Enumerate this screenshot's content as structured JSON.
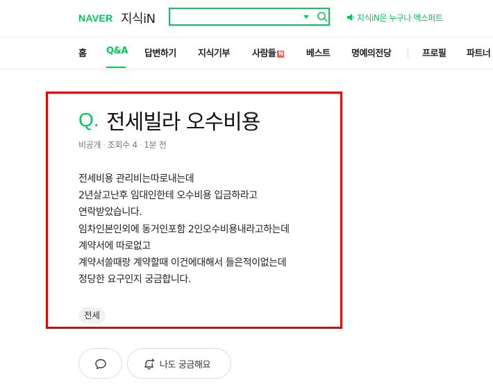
{
  "header": {
    "naver_logo": "NAVER",
    "service_logo": "지식iN",
    "search": {
      "value": "",
      "placeholder": ""
    },
    "notice_text": "지식iN은 누구나 엑스퍼트"
  },
  "nav": {
    "items": [
      {
        "label": "홈"
      },
      {
        "label": "Q&A",
        "active": true
      },
      {
        "label": "답변하기"
      },
      {
        "label": "지식기부"
      },
      {
        "label": "사람들",
        "badge": "N"
      },
      {
        "label": "베스트"
      },
      {
        "label": "명예의전당"
      },
      {
        "label": "프로필"
      },
      {
        "label": "파트너"
      }
    ]
  },
  "question": {
    "q_mark": "Q.",
    "title": "전세빌라 오수비용",
    "meta": {
      "visibility": "비공개",
      "views": "조회수 4",
      "time": "1분 전"
    },
    "body_lines": [
      "전세비용 관리비는따로내는데",
      "2년살고난후 임대인한테 오수비용 입금하라고",
      "연락받았습니다.",
      "임차인본인외에 동거인포함 2인오수비용내라고하는데",
      "계약서에 따로없고",
      "계약서쓸때랑 계약할때 이건에대해서 들은적이없는데",
      "정당한 요구인지 궁금합니다."
    ],
    "tag": "전세"
  },
  "actions": {
    "curious_label": "나도 궁금해요"
  },
  "colors": {
    "brand_green": "#03c75a",
    "highlight_red": "#e60000",
    "badge_red": "#ff5b4f"
  },
  "icons": {
    "search": "search-icon",
    "dropdown": "chevron-down-icon",
    "notice": "speaker-icon",
    "comment": "comment-icon",
    "curious": "bell-plus-icon"
  }
}
